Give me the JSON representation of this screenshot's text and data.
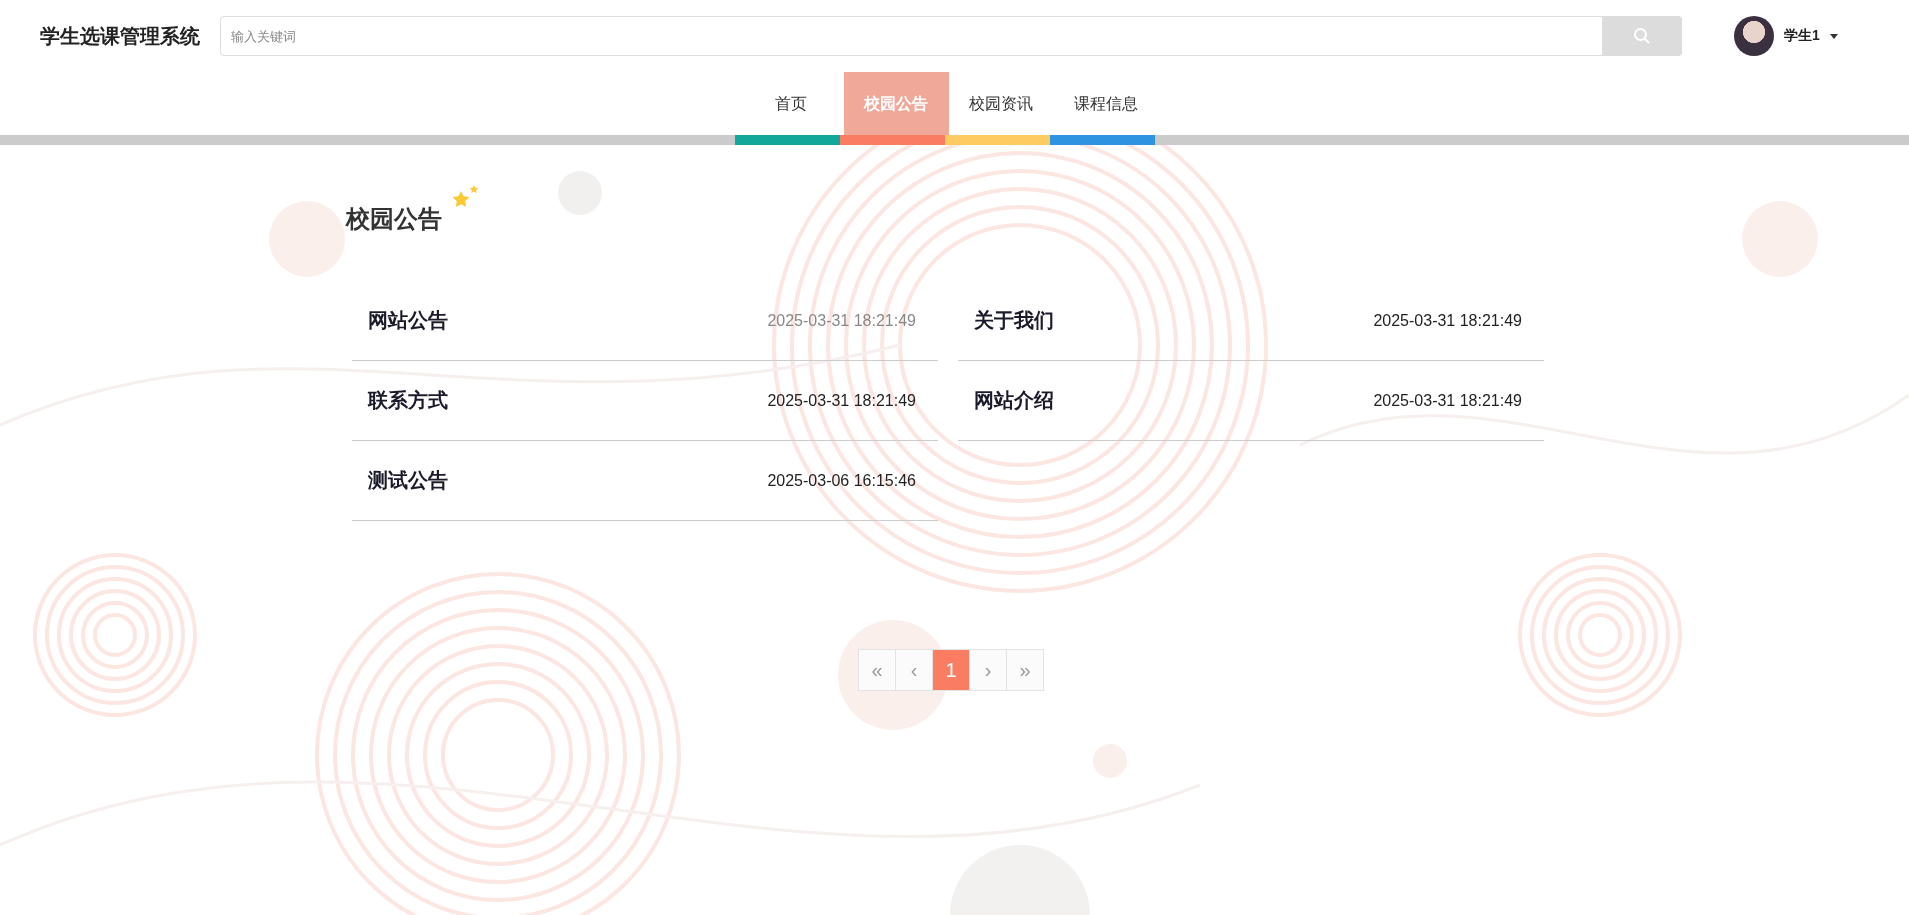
{
  "header": {
    "site_title": "学生选课管理系统",
    "search": {
      "placeholder": "输入关键词"
    },
    "user": {
      "name": "学生1"
    }
  },
  "nav": [
    {
      "label": "首页",
      "selected": false,
      "color": "#11a89a"
    },
    {
      "label": "校园公告",
      "selected": true,
      "color": "#fa7d63"
    },
    {
      "label": "校园资讯",
      "selected": false,
      "color": "#fdcb62"
    },
    {
      "label": "课程信息",
      "selected": false,
      "color": "#2e93e0"
    }
  ],
  "section": {
    "title": "校园公告"
  },
  "notices": [
    {
      "title": "网站公告",
      "time": "2025-03-31 18:21:49",
      "muted": true
    },
    {
      "title": "关于我们",
      "time": "2025-03-31 18:21:49",
      "muted": false
    },
    {
      "title": "联系方式",
      "time": "2025-03-31 18:21:49",
      "muted": false
    },
    {
      "title": "网站介绍",
      "time": "2025-03-31 18:21:49",
      "muted": false
    },
    {
      "title": "测试公告",
      "time": "2025-03-06 16:15:46",
      "muted": false
    }
  ],
  "pagination": [
    {
      "label": "«",
      "selected": false
    },
    {
      "label": "‹",
      "selected": false
    },
    {
      "label": "1",
      "selected": true
    },
    {
      "label": "›",
      "selected": false
    },
    {
      "label": "»",
      "selected": false
    }
  ]
}
